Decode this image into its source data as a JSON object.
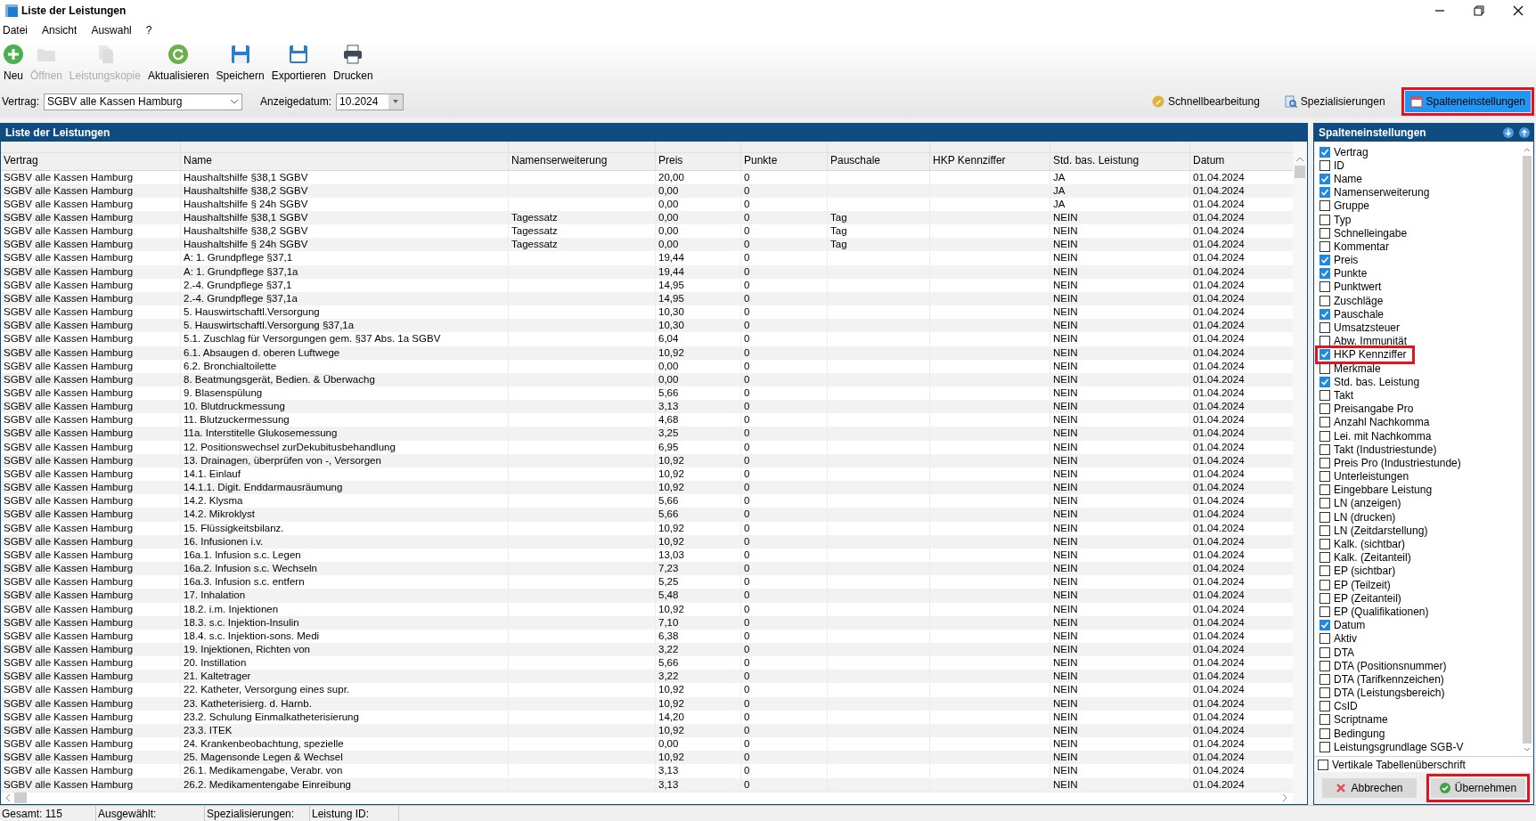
{
  "window": {
    "title": "Liste der Leistungen"
  },
  "menu": [
    "Datei",
    "Ansicht",
    "Auswahl",
    "?"
  ],
  "toolbar": [
    {
      "kind": "new",
      "label": "Neu",
      "disabled": false
    },
    {
      "kind": "open",
      "label": "Öffnen",
      "disabled": true
    },
    {
      "kind": "copy",
      "label": "Leistungskopie",
      "disabled": true
    },
    {
      "kind": "refresh",
      "label": "Aktualisieren",
      "disabled": false
    },
    {
      "kind": "save",
      "label": "Speichern",
      "disabled": false
    },
    {
      "kind": "csv",
      "label": "Exportieren",
      "disabled": false
    },
    {
      "kind": "print",
      "label": "Drucken",
      "disabled": false
    }
  ],
  "filters": {
    "vertrag": {
      "label": "Vertrag:",
      "value": "SGBV alle Kassen Hamburg"
    },
    "datum": {
      "label": "Anzeigedatum:",
      "value": "10.2024"
    }
  },
  "actions": [
    {
      "kind": "pencil",
      "label": "Schnellbearbeitung",
      "highlighted": false
    },
    {
      "kind": "search",
      "label": "Spezialisierungen",
      "highlighted": false
    },
    {
      "kind": "calendar",
      "label": "Spalteneinstellungen",
      "highlighted": true
    }
  ],
  "table": {
    "title": "Liste der Leistungen",
    "columns": [
      "Vertrag",
      "Name",
      "Namenserweiterung",
      "Preis",
      "Punkte",
      "Pauschale",
      "HKP Kennziffer",
      "Std. bas. Leistung",
      "Datum"
    ],
    "rows": [
      [
        "SGBV alle Kassen Hamburg",
        "Haushaltshilfe §38,1 SGBV",
        null,
        "20,00",
        "0",
        null,
        null,
        "JA",
        "01.04.2024"
      ],
      [
        "SGBV alle Kassen Hamburg",
        "Haushaltshilfe §38,2 SGBV",
        null,
        "0,00",
        "0",
        null,
        null,
        "JA",
        "01.04.2024"
      ],
      [
        "SGBV alle Kassen Hamburg",
        "Haushaltshilfe § 24h SGBV",
        null,
        "0,00",
        "0",
        null,
        null,
        "JA",
        "01.04.2024"
      ],
      [
        "SGBV alle Kassen Hamburg",
        "Haushaltshilfe §38,1 SGBV",
        "Tagessatz",
        "0,00",
        "0",
        "Tag",
        null,
        "NEIN",
        "01.04.2024"
      ],
      [
        "SGBV alle Kassen Hamburg",
        "Haushaltshilfe §38,2 SGBV",
        "Tagessatz",
        "0,00",
        "0",
        "Tag",
        null,
        "NEIN",
        "01.04.2024"
      ],
      [
        "SGBV alle Kassen Hamburg",
        "Haushaltshilfe § 24h SGBV",
        "Tagessatz",
        "0,00",
        "0",
        "Tag",
        null,
        "NEIN",
        "01.04.2024"
      ],
      [
        "SGBV alle Kassen Hamburg",
        "A: 1. Grundpflege §37,1",
        null,
        "19,44",
        "0",
        null,
        null,
        "NEIN",
        "01.04.2024"
      ],
      [
        "SGBV alle Kassen Hamburg",
        "A: 1. Grundpflege §37,1a",
        null,
        "19,44",
        "0",
        null,
        null,
        "NEIN",
        "01.04.2024"
      ],
      [
        "SGBV alle Kassen Hamburg",
        "2.-4. Grundpflege §37,1",
        null,
        "14,95",
        "0",
        null,
        null,
        "NEIN",
        "01.04.2024"
      ],
      [
        "SGBV alle Kassen Hamburg",
        "2.-4. Grundpflege §37,1a",
        null,
        "14,95",
        "0",
        null,
        null,
        "NEIN",
        "01.04.2024"
      ],
      [
        "SGBV alle Kassen Hamburg",
        "5. Hauswirtschaftl.Versorgung",
        null,
        "10,30",
        "0",
        null,
        null,
        "NEIN",
        "01.04.2024"
      ],
      [
        "SGBV alle Kassen Hamburg",
        "5. Hauswirtschaftl.Versorgung §37,1a",
        null,
        "10,30",
        "0",
        null,
        null,
        "NEIN",
        "01.04.2024"
      ],
      [
        "SGBV alle Kassen Hamburg",
        "5.1. Zuschlag für Versorgungen gem. §37 Abs. 1a SGBV",
        null,
        "6,04",
        "0",
        null,
        null,
        "NEIN",
        "01.04.2024"
      ],
      [
        "SGBV alle Kassen Hamburg",
        "6.1. Absaugen d. oberen Luftwege",
        null,
        "10,92",
        "0",
        null,
        null,
        "NEIN",
        "01.04.2024"
      ],
      [
        "SGBV alle Kassen Hamburg",
        "6.2. Bronchialtoilette",
        null,
        "0,00",
        "0",
        null,
        null,
        "NEIN",
        "01.04.2024"
      ],
      [
        "SGBV alle Kassen Hamburg",
        "8. Beatmungsgerät, Bedien. & Überwachg",
        null,
        "0,00",
        "0",
        null,
        null,
        "NEIN",
        "01.04.2024"
      ],
      [
        "SGBV alle Kassen Hamburg",
        "9. Blasenspülung",
        null,
        "5,66",
        "0",
        null,
        null,
        "NEIN",
        "01.04.2024"
      ],
      [
        "SGBV alle Kassen Hamburg",
        "10. Blutdruckmessung",
        null,
        "3,13",
        "0",
        null,
        null,
        "NEIN",
        "01.04.2024"
      ],
      [
        "SGBV alle Kassen Hamburg",
        "11. Blutzuckermessung",
        null,
        "4,68",
        "0",
        null,
        null,
        "NEIN",
        "01.04.2024"
      ],
      [
        "SGBV alle Kassen Hamburg",
        "11a. Interstitelle Glukosemessung",
        null,
        "3,25",
        "0",
        null,
        null,
        "NEIN",
        "01.04.2024"
      ],
      [
        "SGBV alle Kassen Hamburg",
        "12. Positionswechsel zurDekubitusbehandlung",
        null,
        "6,95",
        "0",
        null,
        null,
        "NEIN",
        "01.04.2024"
      ],
      [
        "SGBV alle Kassen Hamburg",
        "13. Drainagen, überprüfen von -, Versorgen",
        null,
        "10,92",
        "0",
        null,
        null,
        "NEIN",
        "01.04.2024"
      ],
      [
        "SGBV alle Kassen Hamburg",
        "14.1. Einlauf",
        null,
        "10,92",
        "0",
        null,
        null,
        "NEIN",
        "01.04.2024"
      ],
      [
        "SGBV alle Kassen Hamburg",
        "14.1.1. Digit. Enddarmausräumung",
        null,
        "10,92",
        "0",
        null,
        null,
        "NEIN",
        "01.04.2024"
      ],
      [
        "SGBV alle Kassen Hamburg",
        "14.2. Klysma",
        null,
        "5,66",
        "0",
        null,
        null,
        "NEIN",
        "01.04.2024"
      ],
      [
        "SGBV alle Kassen Hamburg",
        "14.2. Mikroklyst",
        null,
        "5,66",
        "0",
        null,
        null,
        "NEIN",
        "01.04.2024"
      ],
      [
        "SGBV alle Kassen Hamburg",
        "15. Flüssigkeitsbilanz.",
        null,
        "10,92",
        "0",
        null,
        null,
        "NEIN",
        "01.04.2024"
      ],
      [
        "SGBV alle Kassen Hamburg",
        "16. Infusionen i.v.",
        null,
        "10,92",
        "0",
        null,
        null,
        "NEIN",
        "01.04.2024"
      ],
      [
        "SGBV alle Kassen Hamburg",
        "16a.1. Infusion s.c. Legen",
        null,
        "13,03",
        "0",
        null,
        null,
        "NEIN",
        "01.04.2024"
      ],
      [
        "SGBV alle Kassen Hamburg",
        "16a.2. Infusion s.c. Wechseln",
        null,
        "7,23",
        "0",
        null,
        null,
        "NEIN",
        "01.04.2024"
      ],
      [
        "SGBV alle Kassen Hamburg",
        "16a.3. Infusion s.c. entfern",
        null,
        "5,25",
        "0",
        null,
        null,
        "NEIN",
        "01.04.2024"
      ],
      [
        "SGBV alle Kassen Hamburg",
        "17. Inhalation",
        null,
        "5,48",
        "0",
        null,
        null,
        "NEIN",
        "01.04.2024"
      ],
      [
        "SGBV alle Kassen Hamburg",
        "18.2. i.m. Injektionen",
        null,
        "10,92",
        "0",
        null,
        null,
        "NEIN",
        "01.04.2024"
      ],
      [
        "SGBV alle Kassen Hamburg",
        "18.3. s.c. Injektion-Insulin",
        null,
        "7,10",
        "0",
        null,
        null,
        "NEIN",
        "01.04.2024"
      ],
      [
        "SGBV alle Kassen Hamburg",
        "18.4. s.c. Injektion-sons. Medi",
        null,
        "6,38",
        "0",
        null,
        null,
        "NEIN",
        "01.04.2024"
      ],
      [
        "SGBV alle Kassen Hamburg",
        "19. Injektionen, Richten von",
        null,
        "3,22",
        "0",
        null,
        null,
        "NEIN",
        "01.04.2024"
      ],
      [
        "SGBV alle Kassen Hamburg",
        "20. Instillation",
        null,
        "5,66",
        "0",
        null,
        null,
        "NEIN",
        "01.04.2024"
      ],
      [
        "SGBV alle Kassen Hamburg",
        "21. Kaltetrager",
        null,
        "3,22",
        "0",
        null,
        null,
        "NEIN",
        "01.04.2024"
      ],
      [
        "SGBV alle Kassen Hamburg",
        "22. Katheter, Versorgung eines supr.",
        null,
        "10,92",
        "0",
        null,
        null,
        "NEIN",
        "01.04.2024"
      ],
      [
        "SGBV alle Kassen Hamburg",
        "23. Katheterisierg. d. Harnb.",
        null,
        "10,92",
        "0",
        null,
        null,
        "NEIN",
        "01.04.2024"
      ],
      [
        "SGBV alle Kassen Hamburg",
        "23.2. Schulung Einmalkatheterisierung",
        null,
        "14,20",
        "0",
        null,
        null,
        "NEIN",
        "01.04.2024"
      ],
      [
        "SGBV alle Kassen Hamburg",
        "23.3. ITEK",
        null,
        "10,92",
        "0",
        null,
        null,
        "NEIN",
        "01.04.2024"
      ],
      [
        "SGBV alle Kassen Hamburg",
        "24. Krankenbeobachtung, spezielle",
        null,
        "0,00",
        "0",
        null,
        null,
        "NEIN",
        "01.04.2024"
      ],
      [
        "SGBV alle Kassen Hamburg",
        "25. Magensonde Legen & Wechsel",
        null,
        "10,92",
        "0",
        null,
        null,
        "NEIN",
        "01.04.2024"
      ],
      [
        "SGBV alle Kassen Hamburg",
        "26.1. Medikamengabe, Verabr. von",
        null,
        "3,13",
        "0",
        null,
        null,
        "NEIN",
        "01.04.2024"
      ],
      [
        "SGBV alle Kassen Hamburg",
        "26.2. Medikamentengabe Einreibung",
        null,
        "3,13",
        "0",
        null,
        null,
        "NEIN",
        "01.04.2024"
      ]
    ]
  },
  "column_settings": {
    "title": "Spalteneinstellungen",
    "items": [
      {
        "label": "Vertrag",
        "checked": true,
        "highlighted": false
      },
      {
        "label": "ID",
        "checked": false,
        "highlighted": false
      },
      {
        "label": "Name",
        "checked": true,
        "highlighted": false
      },
      {
        "label": "Namenserweiterung",
        "checked": true,
        "highlighted": false
      },
      {
        "label": "Gruppe",
        "checked": false,
        "highlighted": false
      },
      {
        "label": "Typ",
        "checked": false,
        "highlighted": false
      },
      {
        "label": "Schnelleingabe",
        "checked": false,
        "highlighted": false
      },
      {
        "label": "Kommentar",
        "checked": false,
        "highlighted": false
      },
      {
        "label": "Preis",
        "checked": true,
        "highlighted": false
      },
      {
        "label": "Punkte",
        "checked": true,
        "highlighted": false
      },
      {
        "label": "Punktwert",
        "checked": false,
        "highlighted": false
      },
      {
        "label": "Zuschläge",
        "checked": false,
        "highlighted": false
      },
      {
        "label": "Pauschale",
        "checked": true,
        "highlighted": false
      },
      {
        "label": "Umsatzsteuer",
        "checked": false,
        "highlighted": false
      },
      {
        "label": "Abw. Immunität",
        "checked": false,
        "highlighted": false
      },
      {
        "label": "HKP Kennziffer",
        "checked": true,
        "highlighted": true
      },
      {
        "label": "Merkmale",
        "checked": false,
        "highlighted": false
      },
      {
        "label": "Std. bas. Leistung",
        "checked": true,
        "highlighted": false
      },
      {
        "label": "Takt",
        "checked": false,
        "highlighted": false
      },
      {
        "label": "Preisangabe Pro",
        "checked": false,
        "highlighted": false
      },
      {
        "label": "Anzahl Nachkomma",
        "checked": false,
        "highlighted": false
      },
      {
        "label": "Lei. mit Nachkomma",
        "checked": false,
        "highlighted": false
      },
      {
        "label": "Takt (Industriestunde)",
        "checked": false,
        "highlighted": false
      },
      {
        "label": "Preis Pro (Industriestunde)",
        "checked": false,
        "highlighted": false
      },
      {
        "label": "Unterleistungen",
        "checked": false,
        "highlighted": false
      },
      {
        "label": "Eingebbare Leistung",
        "checked": false,
        "highlighted": false
      },
      {
        "label": "LN (anzeigen)",
        "checked": false,
        "highlighted": false
      },
      {
        "label": "LN (drucken)",
        "checked": false,
        "highlighted": false
      },
      {
        "label": "LN (Zeitdarstellung)",
        "checked": false,
        "highlighted": false
      },
      {
        "label": "Kalk. (sichtbar)",
        "checked": false,
        "highlighted": false
      },
      {
        "label": "Kalk. (Zeitanteil)",
        "checked": false,
        "highlighted": false
      },
      {
        "label": "EP (sichtbar)",
        "checked": false,
        "highlighted": false
      },
      {
        "label": "EP (Teilzeit)",
        "checked": false,
        "highlighted": false
      },
      {
        "label": "EP (Zeitanteil)",
        "checked": false,
        "highlighted": false
      },
      {
        "label": "EP (Qualifikationen)",
        "checked": false,
        "highlighted": false
      },
      {
        "label": "Datum",
        "checked": true,
        "highlighted": false
      },
      {
        "label": "Aktiv",
        "checked": false,
        "highlighted": false
      },
      {
        "label": "DTA",
        "checked": false,
        "highlighted": false
      },
      {
        "label": "DTA (Positionsnummer)",
        "checked": false,
        "highlighted": false
      },
      {
        "label": "DTA (Tarifkennzeichen)",
        "checked": false,
        "highlighted": false
      },
      {
        "label": "DTA (Leistungsbereich)",
        "checked": false,
        "highlighted": false
      },
      {
        "label": "CsID",
        "checked": false,
        "highlighted": false
      },
      {
        "label": "Scriptname",
        "checked": false,
        "highlighted": false
      },
      {
        "label": "Bedingung",
        "checked": false,
        "highlighted": false
      },
      {
        "label": "Leistungsgrundlage SGB-V",
        "checked": false,
        "highlighted": false
      }
    ],
    "vertical_header": {
      "label": "Vertikale Tabellenüberschrift",
      "checked": false
    },
    "buttons": [
      {
        "kind": "cancel",
        "label": "Abbrechen",
        "highlighted": false
      },
      {
        "kind": "apply",
        "label": "Übernehmen",
        "highlighted": true
      }
    ]
  },
  "status_bar": [
    "Gesamt: 115",
    "Ausgewählt:",
    "Spezialisierungen:",
    "Leistung ID:"
  ]
}
